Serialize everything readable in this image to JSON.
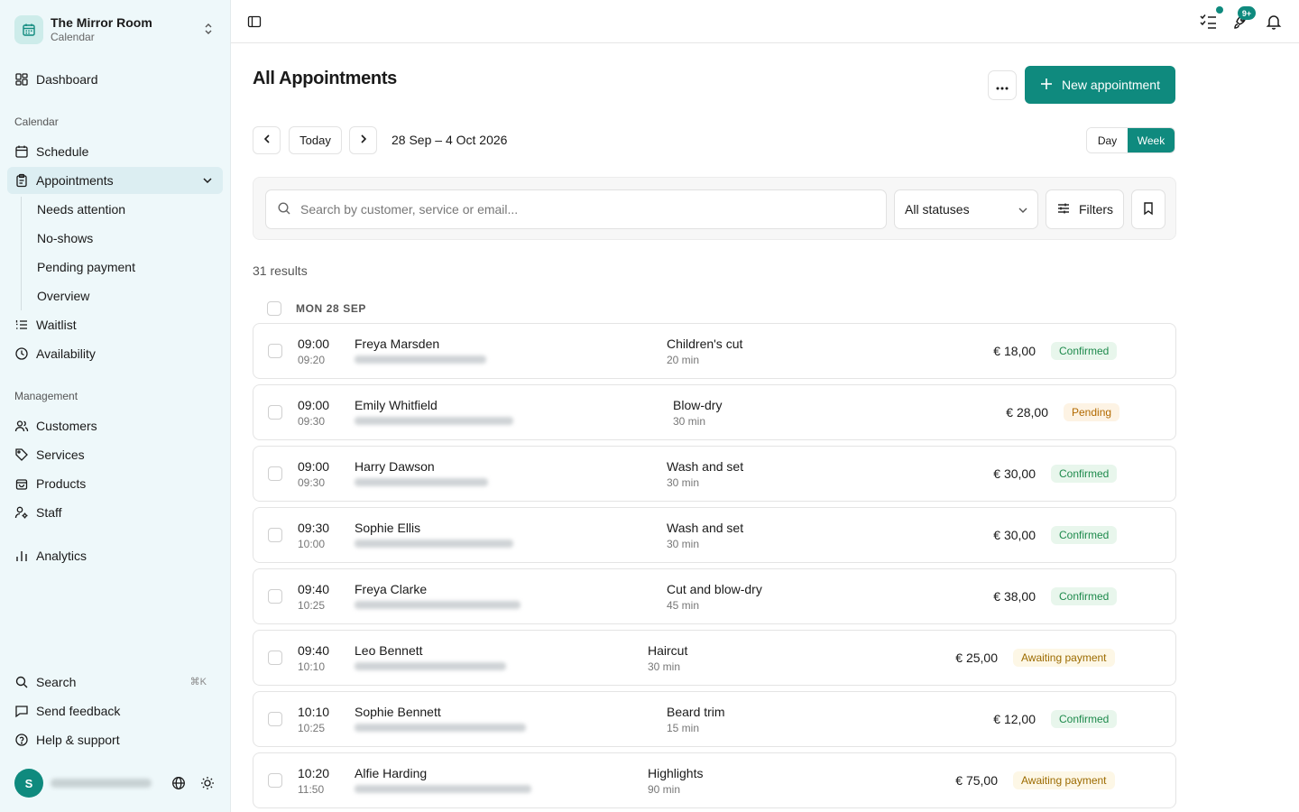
{
  "sidebar": {
    "brand_name": "The Mirror Room",
    "brand_sub": "Calendar",
    "dashboard": "Dashboard",
    "section_calendar": "Calendar",
    "schedule": "Schedule",
    "appointments": "Appointments",
    "sub_items": [
      "Needs attention",
      "No-shows",
      "Pending payment",
      "Overview"
    ],
    "waitlist": "Waitlist",
    "availability": "Availability",
    "section_management": "Management",
    "customers": "Customers",
    "services": "Services",
    "products": "Products",
    "staff": "Staff",
    "analytics": "Analytics",
    "search": "Search",
    "search_shortcut": "⌘K",
    "feedback": "Send feedback",
    "help": "Help & support",
    "avatar_initial": "S"
  },
  "topbar": {
    "notifications_badge": "9+"
  },
  "main": {
    "title": "All Appointments",
    "new_button": "New appointment",
    "today": "Today",
    "date_range": "28 Sep – 4 Oct 2026",
    "view_day": "Day",
    "view_week": "Week",
    "search_placeholder": "Search by customer, service or email...",
    "status_filter": "All statuses",
    "filters_label": "Filters",
    "results": "31 results",
    "group_label": "MON 28 SEP"
  },
  "colors": {
    "accent": "#0f8a7e",
    "sidebar_bg": "#eef8fa",
    "confirmed": "#1e8a4c",
    "pending": "#b26a00",
    "awaiting": "#9c6b00"
  },
  "appointments": [
    {
      "start": "09:00",
      "end": "09:20",
      "name": "Freya Marsden",
      "service": "Children's cut",
      "duration": "20 min",
      "price": "€ 18,00",
      "status": "Confirmed"
    },
    {
      "start": "09:00",
      "end": "09:30",
      "name": "Emily Whitfield",
      "service": "Blow-dry",
      "duration": "30 min",
      "price": "€ 28,00",
      "status": "Pending"
    },
    {
      "start": "09:00",
      "end": "09:30",
      "name": "Harry Dawson",
      "service": "Wash and set",
      "duration": "30 min",
      "price": "€ 30,00",
      "status": "Confirmed"
    },
    {
      "start": "09:30",
      "end": "10:00",
      "name": "Sophie Ellis",
      "service": "Wash and set",
      "duration": "30 min",
      "price": "€ 30,00",
      "status": "Confirmed"
    },
    {
      "start": "09:40",
      "end": "10:25",
      "name": "Freya Clarke",
      "service": "Cut and blow-dry",
      "duration": "45 min",
      "price": "€ 38,00",
      "status": "Confirmed"
    },
    {
      "start": "09:40",
      "end": "10:10",
      "name": "Leo Bennett",
      "service": "Haircut",
      "duration": "30 min",
      "price": "€ 25,00",
      "status": "Awaiting payment"
    },
    {
      "start": "10:10",
      "end": "10:25",
      "name": "Sophie Bennett",
      "service": "Beard trim",
      "duration": "15 min",
      "price": "€ 12,00",
      "status": "Confirmed"
    },
    {
      "start": "10:20",
      "end": "11:50",
      "name": "Alfie Harding",
      "service": "Highlights",
      "duration": "90 min",
      "price": "€ 75,00",
      "status": "Awaiting payment"
    }
  ]
}
